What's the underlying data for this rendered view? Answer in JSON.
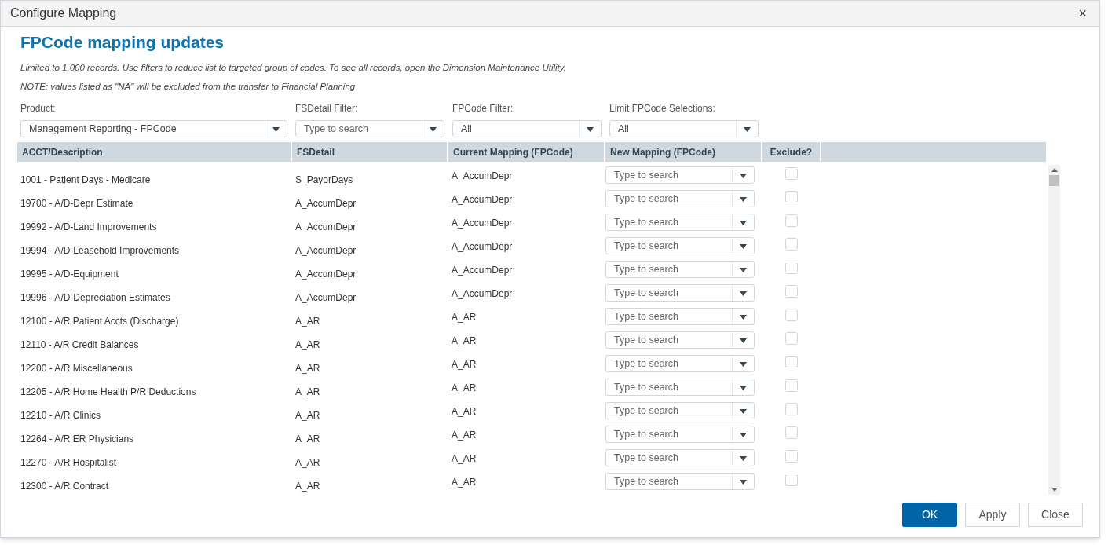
{
  "window": {
    "title": "Configure Mapping",
    "close": "×"
  },
  "heading": "FPCode mapping updates",
  "notes": [
    "Limited to 1,000 records. Use filters to reduce list to targeted group of codes. To see all records, open the Dimension Maintenance Utility.",
    "NOTE: values listed as \"NA\" will be excluded from the transfer to Financial Planning"
  ],
  "filters": [
    {
      "label": "Product:",
      "value": "Management Reporting - FPCode"
    },
    {
      "label": "FSDetail Filter:",
      "placeholder": "Type to search"
    },
    {
      "label": "FPCode Filter:",
      "value": "All"
    },
    {
      "label": "Limit FPCode Selections:",
      "value": "All"
    }
  ],
  "table": {
    "columns": [
      "ACCT/Description",
      "FSDetail",
      "Current Mapping (FPCode)",
      "New Mapping (FPCode)",
      "Exclude?"
    ],
    "rows": [
      {
        "acct": "1001 - Patient Days - Medicare",
        "fsdetail": "S_PayorDays",
        "current": "A_AccumDepr",
        "new_placeholder": "Type to search",
        "exclude": false
      },
      {
        "acct": "19700 - A/D-Depr Estimate",
        "fsdetail": "A_AccumDepr",
        "current": "A_AccumDepr",
        "new_placeholder": "Type to search",
        "exclude": false
      },
      {
        "acct": "19992 - A/D-Land Improvements",
        "fsdetail": "A_AccumDepr",
        "current": "A_AccumDepr",
        "new_placeholder": "Type to search",
        "exclude": false
      },
      {
        "acct": "19994 - A/D-Leasehold Improvements",
        "fsdetail": "A_AccumDepr",
        "current": "A_AccumDepr",
        "new_placeholder": "Type to search",
        "exclude": false
      },
      {
        "acct": "19995 - A/D-Equipment",
        "fsdetail": "A_AccumDepr",
        "current": "A_AccumDepr",
        "new_placeholder": "Type to search",
        "exclude": false
      },
      {
        "acct": "19996 - A/D-Depreciation Estimates",
        "fsdetail": "A_AccumDepr",
        "current": "A_AccumDepr",
        "new_placeholder": "Type to search",
        "exclude": false
      },
      {
        "acct": "12100 - A/R Patient Accts (Discharge)",
        "fsdetail": "A_AR",
        "current": "A_AR",
        "new_placeholder": "Type to search",
        "exclude": false
      },
      {
        "acct": "12110 - A/R Credit Balances",
        "fsdetail": "A_AR",
        "current": "A_AR",
        "new_placeholder": "Type to search",
        "exclude": false
      },
      {
        "acct": "12200 - A/R Miscellaneous",
        "fsdetail": "A_AR",
        "current": "A_AR",
        "new_placeholder": "Type to search",
        "exclude": false
      },
      {
        "acct": "12205 - A/R Home Health P/R Deductions",
        "fsdetail": "A_AR",
        "current": "A_AR",
        "new_placeholder": "Type to search",
        "exclude": false
      },
      {
        "acct": "12210 - A/R Clinics",
        "fsdetail": "A_AR",
        "current": "A_AR",
        "new_placeholder": "Type to search",
        "exclude": false
      },
      {
        "acct": "12264 - A/R ER Physicians",
        "fsdetail": "A_AR",
        "current": "A_AR",
        "new_placeholder": "Type to search",
        "exclude": false
      },
      {
        "acct": "12270 - A/R Hospitalist",
        "fsdetail": "A_AR",
        "current": "A_AR",
        "new_placeholder": "Type to search",
        "exclude": false
      },
      {
        "acct": "12300 - A/R Contract",
        "fsdetail": "A_AR",
        "current": "A_AR",
        "new_placeholder": "Type to search",
        "exclude": false
      }
    ]
  },
  "buttons": [
    {
      "label": "OK",
      "kind": "primary"
    },
    {
      "label": "Apply",
      "kind": "secondary"
    },
    {
      "label": "Close",
      "kind": "secondary"
    }
  ]
}
